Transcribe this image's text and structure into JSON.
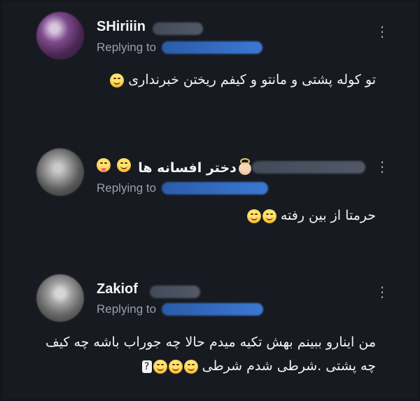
{
  "posts": [
    {
      "name": "SHiriiin",
      "replying_to": "Replying to",
      "menu": "⋮",
      "text": "تو کوله پشتی و مانتو و کیفم ریختن خبرنداری",
      "emoji": [
        "grinning-face-with-sweat"
      ]
    },
    {
      "name": "دختر افسانه ها",
      "replying_to": "Replying to",
      "menu": "⋮",
      "text": "حرمتا از بین رفته",
      "emoji": [
        "grinning-face-with-sweat",
        "grinning-face-with-sweat"
      ]
    },
    {
      "name": "Zakiof",
      "replying_to": "Replying to",
      "menu": "⋮",
      "text_line_1": "من اینارو ببینم بهش تکیه میدم حالا چه جوراب باشه چه کیف",
      "text_line_2": "چه پشتی .شرطی شدم شرطی",
      "emoji": [
        "grinning-face-with-sweat",
        "grinning-face-with-sweat",
        "grinning-face-with-sweat"
      ],
      "replacement_char": "?"
    }
  ]
}
